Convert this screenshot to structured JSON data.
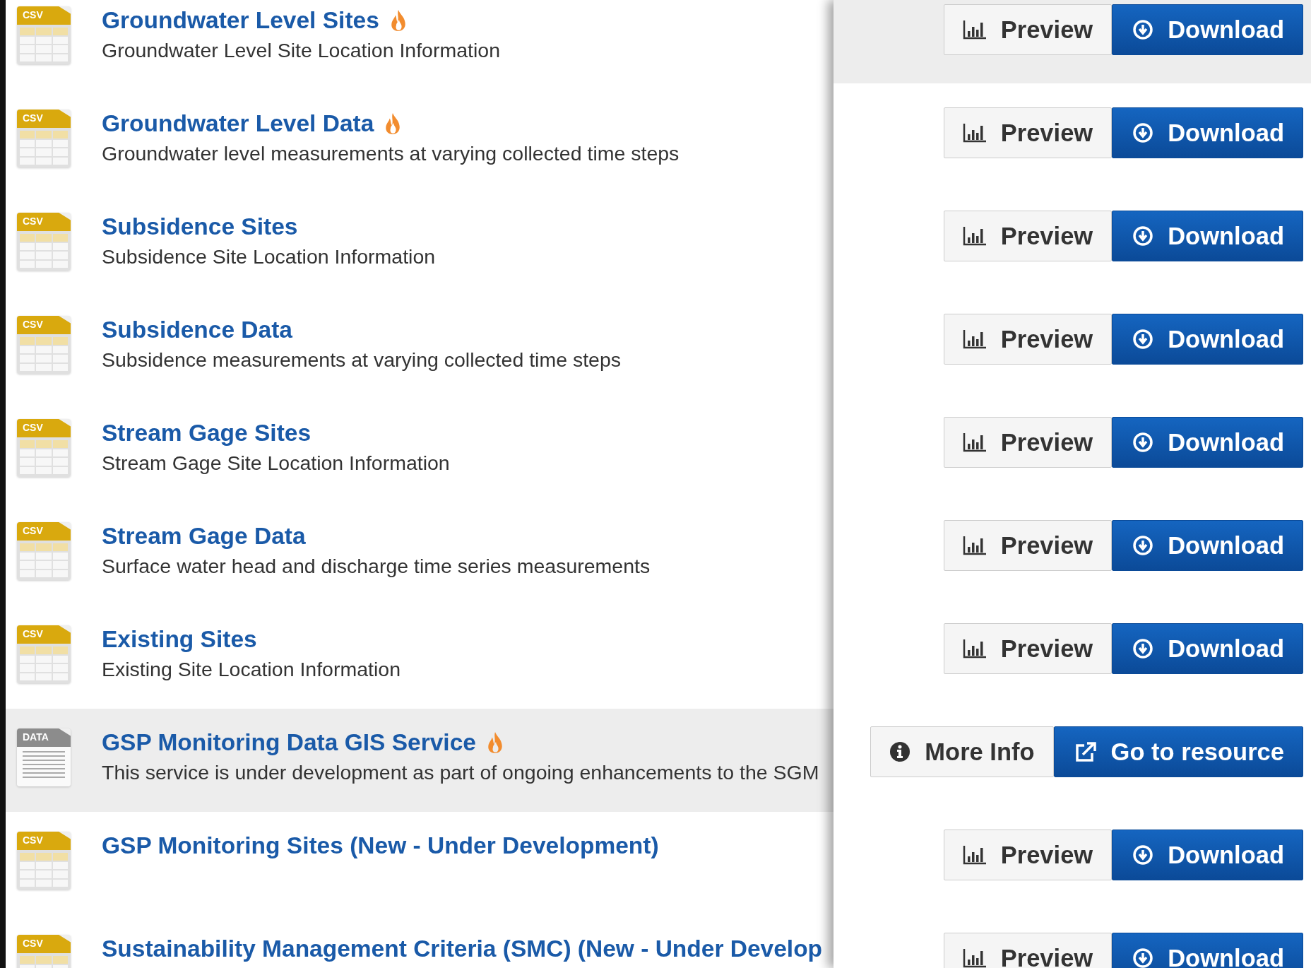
{
  "resources": [
    {
      "title": "Groundwater Level Sites",
      "description": "Groundwater Level Site Location Information",
      "format": "CSV",
      "kind": "table",
      "popular": true,
      "highlighted": false
    },
    {
      "title": "Groundwater Level Data",
      "description": "Groundwater level measurements at varying collected time steps",
      "format": "CSV",
      "kind": "table",
      "popular": true,
      "highlighted": false
    },
    {
      "title": "Subsidence Sites",
      "description": "Subsidence Site Location Information",
      "format": "CSV",
      "kind": "table",
      "popular": false,
      "highlighted": false
    },
    {
      "title": "Subsidence Data",
      "description": "Subsidence measurements at varying collected time steps",
      "format": "CSV",
      "kind": "table",
      "popular": false,
      "highlighted": false
    },
    {
      "title": "Stream Gage Sites",
      "description": "Stream Gage Site Location Information",
      "format": "CSV",
      "kind": "table",
      "popular": false,
      "highlighted": false
    },
    {
      "title": "Stream Gage Data",
      "description": "Surface water head and discharge time series measurements",
      "format": "CSV",
      "kind": "table",
      "popular": false,
      "highlighted": false
    },
    {
      "title": "Existing Sites",
      "description": "Existing Site Location Information",
      "format": "CSV",
      "kind": "table",
      "popular": false,
      "highlighted": false
    },
    {
      "title": "GSP Monitoring Data GIS Service",
      "description": "This service is under development as part of ongoing enhancements to the SGM",
      "format": "DATA",
      "kind": "document",
      "popular": true,
      "highlighted": true
    },
    {
      "title": "GSP Monitoring Sites (New - Under Development)",
      "format": "CSV",
      "kind": "table",
      "popular": false,
      "highlighted": false
    },
    {
      "title": "Sustainability Management Criteria (SMC) (New - Under Develop",
      "format": "CSV",
      "kind": "table",
      "popular": false,
      "highlighted": false
    }
  ],
  "actions": [
    {
      "highlighted": true,
      "buttons": [
        {
          "kind": "preview",
          "label": "Preview"
        },
        {
          "kind": "download",
          "label": "Download"
        }
      ]
    },
    {
      "highlighted": false,
      "buttons": [
        {
          "kind": "preview",
          "label": "Preview"
        },
        {
          "kind": "download",
          "label": "Download"
        }
      ]
    },
    {
      "highlighted": false,
      "buttons": [
        {
          "kind": "preview",
          "label": "Preview"
        },
        {
          "kind": "download",
          "label": "Download"
        }
      ]
    },
    {
      "highlighted": false,
      "buttons": [
        {
          "kind": "preview",
          "label": "Preview"
        },
        {
          "kind": "download",
          "label": "Download"
        }
      ]
    },
    {
      "highlighted": false,
      "buttons": [
        {
          "kind": "preview",
          "label": "Preview"
        },
        {
          "kind": "download",
          "label": "Download"
        }
      ]
    },
    {
      "highlighted": false,
      "buttons": [
        {
          "kind": "preview",
          "label": "Preview"
        },
        {
          "kind": "download",
          "label": "Download"
        }
      ]
    },
    {
      "highlighted": false,
      "buttons": [
        {
          "kind": "preview",
          "label": "Preview"
        },
        {
          "kind": "download",
          "label": "Download"
        }
      ]
    },
    {
      "highlighted": false,
      "buttons": [
        {
          "kind": "info",
          "label": "More Info"
        },
        {
          "kind": "external",
          "label": "Go to resource"
        }
      ]
    },
    {
      "highlighted": false,
      "buttons": [
        {
          "kind": "preview",
          "label": "Preview"
        },
        {
          "kind": "download",
          "label": "Download"
        }
      ]
    },
    {
      "highlighted": false,
      "buttons": [
        {
          "kind": "preview",
          "label": "Preview"
        },
        {
          "kind": "download",
          "label": "Download"
        }
      ]
    }
  ]
}
